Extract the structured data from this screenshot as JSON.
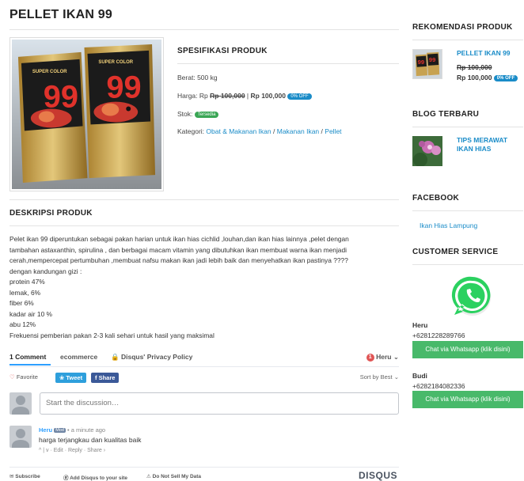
{
  "product": {
    "title": "PELLET IKAN 99",
    "image_icon": "fish-food-pouch-image"
  },
  "spec": {
    "heading": "SPESIFIKASI PRODUK",
    "weight_label": "Berat:",
    "weight_value": "500 kg",
    "price_label": "Harga: Rp",
    "price_old": "Rp 100,000",
    "price_sep": "|",
    "price_new": "Rp 100,000",
    "discount_badge": "0% OFF",
    "stock_label": "Stok:",
    "stock_badge": "Tersedia",
    "category_label": "Kategori:",
    "categories": [
      "Obat & Makanan Ikan",
      "Makanan Ikan",
      "Pellet"
    ],
    "category_sep": "/"
  },
  "description": {
    "heading": "DESKRIPSI PRODUK",
    "lines": [
      "Pelet ikan 99 diperuntukan sebagai pakan harian untuk ikan hias cichlid ,louhan,dan ikan hias lainnya ,pelet dengan",
      "tambahan astaxanthin, spirulina , dan berbagai macam vitamin yang dibutuhkan ikan membuat warna ikan menjadi",
      "cerah,mempercepat pertumbuhan ,membuat nafsu makan ikan jadi lebih baik dan menyehatkan ikan pastinya ????",
      "dengan kandungan gizi :",
      "protein 47%",
      "lemak, 6%",
      "fiber 6%",
      "kadar air 10 %",
      "abu 12%",
      "Frekuensi pemberian pakan 2-3 kali sehari untuk hasil yang maksimal"
    ]
  },
  "disqus": {
    "tab_comments": "1 Comment",
    "tab_community": "ecommerce",
    "tab_privacy": "Disqus' Privacy Policy",
    "user_badge": "1",
    "user_name": "Heru",
    "favorite": "Favorite",
    "tweet": "Tweet",
    "share": "Share",
    "sort": "Sort by Best",
    "input_placeholder": "Start the discussion…",
    "comment": {
      "author": "Heru",
      "mod_badge": "Mod",
      "time": "a minute ago",
      "text": "harga terjangkau dan kualitas baik",
      "actions": "^ | v  ·  Edit  ·  Reply  ·  Share ›"
    },
    "footer": {
      "subscribe": "Subscribe",
      "add": "Add Disqus to your site",
      "dns": "Do Not Sell My Data",
      "logo": "DISQUS"
    }
  },
  "sidebar": {
    "rec_heading": "REKOMENDASI PRODUK",
    "rec_name": "PELLET IKAN 99",
    "rec_price_old": "Rp 100,000",
    "rec_price_new": "Rp 100,000",
    "rec_badge": "0% OFF",
    "blog_heading": "BLOG TERBARU",
    "blog_title": "TIPS MERAWAT IKAN HIAS",
    "fb_heading": "FACEBOOK",
    "fb_link": "Ikan Hias Lampung",
    "cs_heading": "CUSTOMER SERVICE",
    "cs1_name": "Heru",
    "cs1_phone": "+6281228289766",
    "cs1_button": "Chat via Whatsapp (klik disini)",
    "cs2_name": "Budi",
    "cs2_phone": "+6282184082336",
    "cs2_button": "Chat via Whatsapp (klik disini)"
  },
  "colors": {
    "link": "#1a8cc8",
    "whatsapp_green": "#48b96a",
    "badge_blue": "#1a8cc8",
    "badge_green": "#3aa655"
  }
}
